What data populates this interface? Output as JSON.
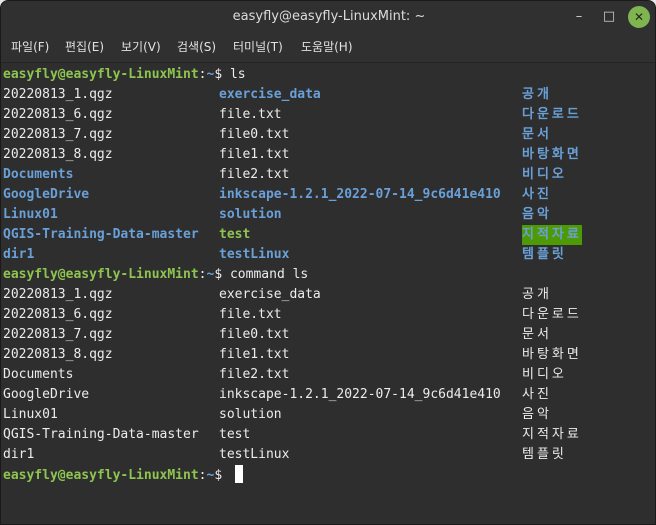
{
  "window": {
    "title": "easyfly@easyfly-LinuxMint: ~",
    "minimize_glyph": "–",
    "maximize_glyph": "□",
    "close_glyph": "✕",
    "accent_color": "#7fb450"
  },
  "menu": [
    "파일(F)",
    "편집(E)",
    "보기(V)",
    "검색(S)",
    "터미널(T)",
    "도움말(H)"
  ],
  "prompt": {
    "user": "easyfly@easyfly-LinuxMint",
    "sep": ":",
    "path": "~",
    "symbol": "$"
  },
  "commands": [
    "ls",
    "command ls"
  ],
  "listing": [
    [
      "20220813_1.qgz",
      "exercise_data",
      "공개"
    ],
    [
      "20220813_6.qgz",
      "file.txt",
      "다운로드"
    ],
    [
      "20220813_7.qgz",
      "file0.txt",
      "문서"
    ],
    [
      "20220813_8.qgz",
      "file1.txt",
      "바탕화면"
    ],
    [
      "Documents",
      "file2.txt",
      "비디오"
    ],
    [
      "GoogleDrive",
      "inkscape-1.2.1_2022-07-14_9c6d41e410",
      "사진"
    ],
    [
      "Linux01",
      "solution",
      "음악"
    ],
    [
      "QGIS-Training-Data-master",
      "test",
      "지적자료"
    ],
    [
      "dir1",
      "testLinux",
      "템플릿"
    ]
  ],
  "listing_styles": [
    [
      "file",
      "dir",
      "dir"
    ],
    [
      "file",
      "file",
      "dir"
    ],
    [
      "file",
      "file",
      "dir"
    ],
    [
      "file",
      "file",
      "dir"
    ],
    [
      "dir",
      "file",
      "dir"
    ],
    [
      "dir",
      "dir",
      "dir"
    ],
    [
      "dir",
      "dir",
      "dir"
    ],
    [
      "dir",
      "exec",
      "sticky"
    ],
    [
      "dir",
      "dir",
      "dir"
    ]
  ],
  "colors": {
    "user": "#8ec550",
    "directory": "#6aa0d8",
    "executable": "#8ec550",
    "sticky_bg": "#4e9a06",
    "text": "#ececec",
    "background": "#2e2e2e"
  }
}
